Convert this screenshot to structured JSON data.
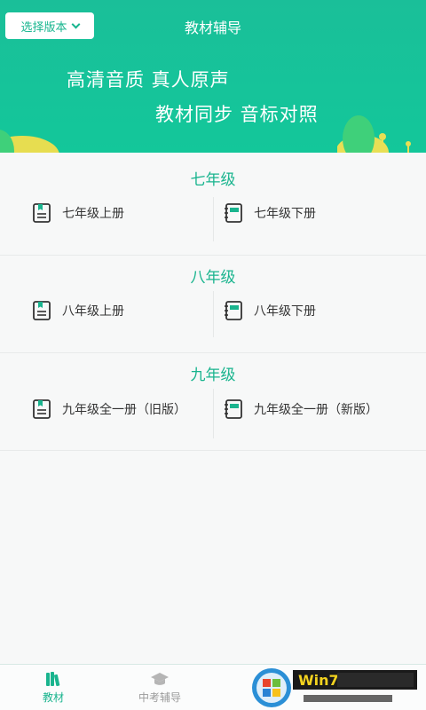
{
  "header": {
    "version_button": "选择版本",
    "title": "教材辅导",
    "slogan_line1": "高清音质 真人原声",
    "slogan_line2": "教材同步 音标对照"
  },
  "grades": [
    {
      "title": "七年级",
      "books": [
        {
          "label": "七年级上册"
        },
        {
          "label": "七年级下册"
        }
      ]
    },
    {
      "title": "八年级",
      "books": [
        {
          "label": "八年级上册"
        },
        {
          "label": "八年级下册"
        }
      ]
    },
    {
      "title": "九年级",
      "books": [
        {
          "label": "九年级全一册（旧版）"
        },
        {
          "label": "九年级全一册（新版）"
        }
      ]
    }
  ],
  "tabbar": {
    "tabs": [
      {
        "label": "教材",
        "icon": "books-icon",
        "active": true
      },
      {
        "label": "中考辅导",
        "icon": "graduation-cap-icon",
        "active": false
      }
    ]
  },
  "colors": {
    "brand": "#13c79a",
    "accent_text": "#19b48e",
    "inactive_text": "#9a9a9a"
  }
}
